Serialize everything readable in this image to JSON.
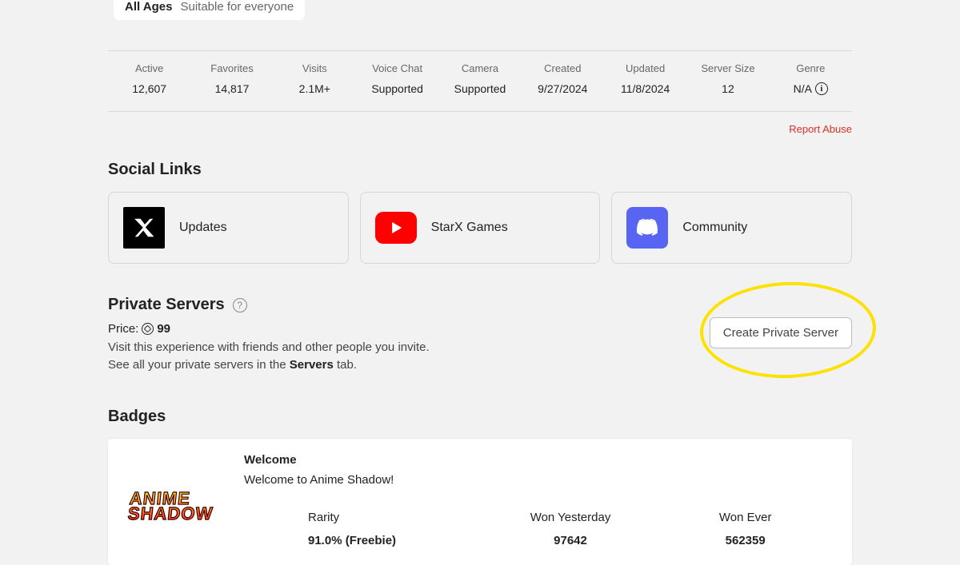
{
  "rating": {
    "age": "All Ages",
    "suitability": "Suitable for everyone"
  },
  "stats": [
    {
      "label": "Active",
      "value": "12,607"
    },
    {
      "label": "Favorites",
      "value": "14,817"
    },
    {
      "label": "Visits",
      "value": "2.1M+"
    },
    {
      "label": "Voice Chat",
      "value": "Supported"
    },
    {
      "label": "Camera",
      "value": "Supported"
    },
    {
      "label": "Created",
      "value": "9/27/2024"
    },
    {
      "label": "Updated",
      "value": "11/8/2024"
    },
    {
      "label": "Server Size",
      "value": "12"
    },
    {
      "label": "Genre",
      "value": "N/A",
      "info": true
    }
  ],
  "report_abuse": "Report Abuse",
  "social": {
    "heading": "Social Links",
    "links": [
      {
        "label": "Updates"
      },
      {
        "label": "StarX Games"
      },
      {
        "label": "Community"
      }
    ]
  },
  "private_servers": {
    "heading": "Private Servers",
    "price_label": "Price:",
    "price_value": "99",
    "desc_line1": "Visit this experience with friends and other people you invite.",
    "desc_line2_a": "See all your private servers in the ",
    "desc_line2_b": "Servers",
    "desc_line2_c": " tab.",
    "create_button": "Create Private Server"
  },
  "badges": {
    "heading": "Badges",
    "badge": {
      "logo_line1": "ANIME",
      "logo_line2": "SHADOW",
      "title": "Welcome",
      "desc": "Welcome to Anime Shadow!",
      "cols": [
        {
          "label": "Rarity",
          "value": "91.0% (Freebie)"
        },
        {
          "label": "Won Yesterday",
          "value": "97642"
        },
        {
          "label": "Won Ever",
          "value": "562359"
        }
      ]
    }
  }
}
